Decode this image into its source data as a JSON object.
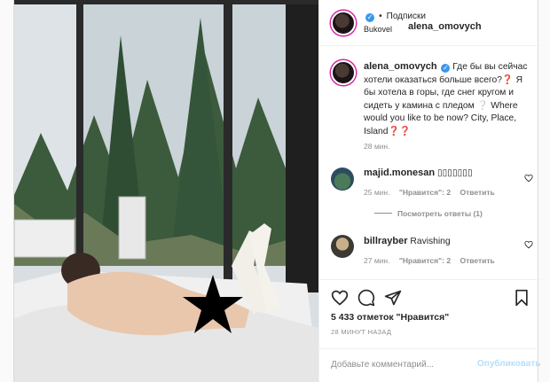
{
  "post": {
    "username": "alena_omovych",
    "follow_label": "Подписки",
    "location": "Bukovel"
  },
  "caption": {
    "username": "alena_omovych",
    "text": "Где бы вы сейчас хотели оказаться больше всего?❓ Я бы хотела в горы, где снег кругом и сидеть у камина с пледом ❔ Where would you like to be now? City, Place, Island❓❓",
    "time": "28 мин."
  },
  "comments": [
    {
      "username": "majid.monesan",
      "text": "▯▯▯▯▯▯▯",
      "time": "25 мин.",
      "likes": "\"Нравится\": 2",
      "reply": "Ответить"
    },
    {
      "username": "billrayber",
      "text": "Ravishing",
      "time": "27 мин.",
      "likes": "\"Нравится\": 2",
      "reply": "Ответить"
    }
  ],
  "view_replies": "Посмотреть ответы (1)",
  "likes_text": "5 433 отметок \"Нравится\"",
  "posted_ago": "28 МИНУТ НАЗАД",
  "composer": {
    "placeholder": "Добавьте комментарий...",
    "publish_label": "Опубликовать"
  },
  "icons": [
    "verified-icon",
    "heart-icon",
    "comment-icon",
    "share-icon",
    "bookmark-icon"
  ],
  "colors": {
    "verified": "#3897f0",
    "publish": "#b2dffc",
    "muted": "#8e8e8e"
  }
}
